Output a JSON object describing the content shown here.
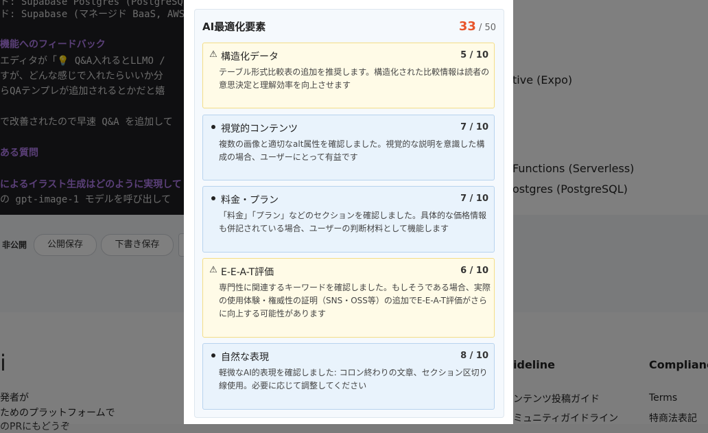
{
  "background": {
    "editor_lines": [
      "ド: Supabase Postgres (PostgreSQL)",
      "ド: Supabase (マネージド BaaS, AWS",
      "機能へのフィードバック",
      "エディタが「💡 Q&A入れるとLLMO /",
      "すが、どんな感じで入れたらいいか分",
      "らQAテンプレが追加されるとかだと嬉",
      "で改善されたので早速 Q&A を追加して",
      "ある質問",
      "によるイラスト生成はどのように実現して",
      "の gpt-image-1 モデルを呼び出して"
    ],
    "right_lines": [
      "tive (Expo)",
      "Functions (Serverless)",
      "ostgres (PostgreSQL)"
    ],
    "toolbar": {
      "visibility": "非公開",
      "publish_save": "公開保存",
      "draft_save": "下書き保存"
    },
    "footer": {
      "brand": "i",
      "tagline_1": "発者が",
      "tagline_2": "ためのプラットフォームで",
      "tagline_3": "のPRにもどうぞ",
      "guideline_heading": "ideline",
      "guideline_links": [
        "ンテンツ投稿ガイド",
        "ミュニティガイドライン"
      ],
      "compliance_heading": "Compliance",
      "compliance_links": [
        "Terms",
        "特商法表記"
      ]
    }
  },
  "modal": {
    "title": "AI最適化要素",
    "score": "33",
    "score_max": "/ 50",
    "items": [
      {
        "icon": "warning-icon",
        "glyph": "⚠",
        "title": "構造化データ",
        "score": "5 / 10",
        "status": "warn",
        "description": "テーブル形式比較表の追加を推奨します。構造化された比較情報は読者の意思決定と理解効率を向上させます"
      },
      {
        "icon": "bullet-icon",
        "glyph": "",
        "title": "視覚的コンテンツ",
        "score": "7 / 10",
        "status": "info",
        "description": "複数の画像と適切なalt属性を確認しました。視覚的な説明を意識した構成の場合、ユーザーにとって有益です"
      },
      {
        "icon": "bullet-icon",
        "glyph": "",
        "title": "料金・プラン",
        "score": "7 / 10",
        "status": "info",
        "description": "「料金」「プラン」などのセクションを確認しました。具体的な価格情報も併記されている場合、ユーザーの判断材料として機能します"
      },
      {
        "icon": "warning-icon",
        "glyph": "⚠",
        "title": "E-E-A-T評価",
        "score": "6 / 10",
        "status": "warn",
        "description": "専門性に関連するキーワードを確認しました。もしそうである場合、実際の使用体験・権威性の証明（SNS・OSS等）の追加でE-E-A-T評価がさらに向上する可能性があります"
      },
      {
        "icon": "bullet-icon",
        "glyph": "",
        "title": "自然な表現",
        "score": "8 / 10",
        "status": "info",
        "description": "軽微なAI的表現を確認しました: コロン終わりの文章、セクション区切り線使用。必要に応じて調整してください"
      }
    ]
  }
}
